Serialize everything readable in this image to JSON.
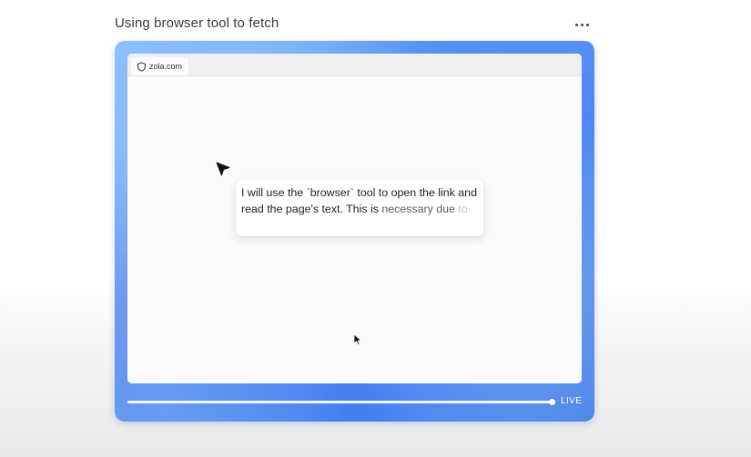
{
  "header": {
    "title": "Using browser tool to fetch"
  },
  "browser": {
    "tab": {
      "icon": "shield-icon",
      "label": "zola.com"
    }
  },
  "message": {
    "text_main": "I will use the `browser` tool to open the link and read the page's text. This is",
    "text_faded_1": "necessary due",
    "text_faded_2": "to"
  },
  "playback": {
    "progress": 1.0,
    "live_label": "LIVE"
  },
  "colors": {
    "frame_accent": "#5b9af0",
    "frame_light": "#8ec0f6",
    "page_background": "#fbfbfb"
  }
}
